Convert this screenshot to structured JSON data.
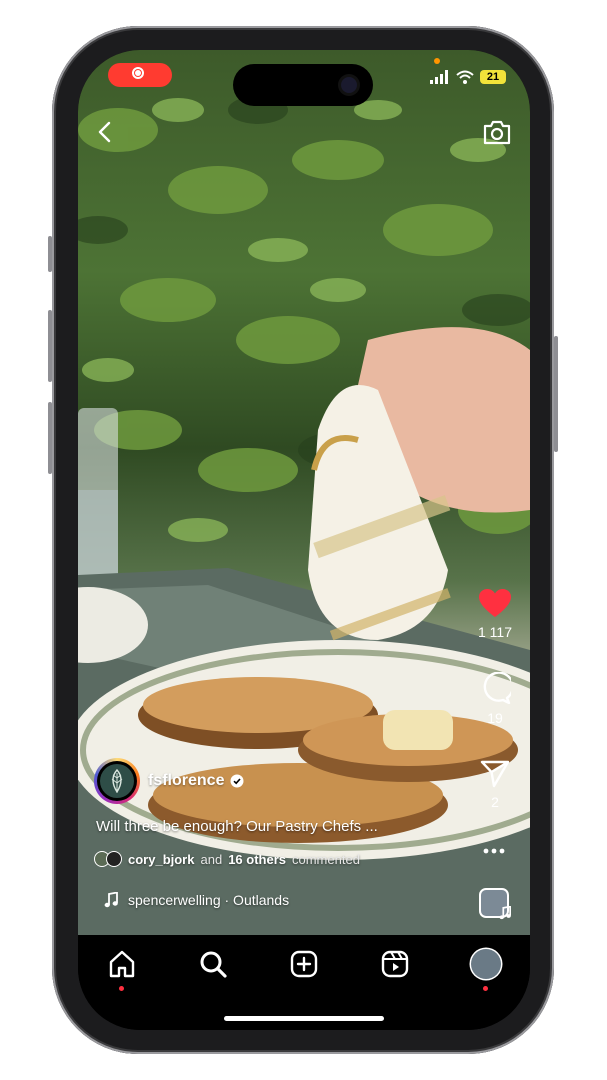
{
  "status_bar": {
    "battery": "21",
    "recording": true
  },
  "post": {
    "username": "fsflorence",
    "verified": true,
    "caption": "Will three be enough? Our Pastry Chefs ...",
    "commenters": {
      "first_user": "cory_bjork",
      "connector": "and",
      "others": "16 others",
      "suffix": "commented"
    },
    "audio": "spencerwelling · Outlands"
  },
  "actions": {
    "likes": "1 117",
    "comments": "19",
    "shares": "2",
    "liked": true
  },
  "icons": {
    "back": "chevron-left-icon",
    "camera": "camera-icon",
    "like": "heart-icon",
    "comment": "comment-bubble-icon",
    "share": "paper-plane-icon",
    "more": "more-dots-icon",
    "music": "music-note-icon"
  },
  "tabs": [
    {
      "name": "home",
      "icon": "home-icon",
      "notification_dot": true
    },
    {
      "name": "search",
      "icon": "search-icon",
      "notification_dot": false
    },
    {
      "name": "create",
      "icon": "plus-square-icon",
      "notification_dot": false
    },
    {
      "name": "reels",
      "icon": "reels-icon",
      "notification_dot": false
    },
    {
      "name": "profile",
      "icon": "profile-avatar",
      "notification_dot": true
    }
  ],
  "colors": {
    "like_red": "#ff3040",
    "record_red": "#ff3b30",
    "battery_yellow": "#f2e33a",
    "background": "#000000"
  }
}
